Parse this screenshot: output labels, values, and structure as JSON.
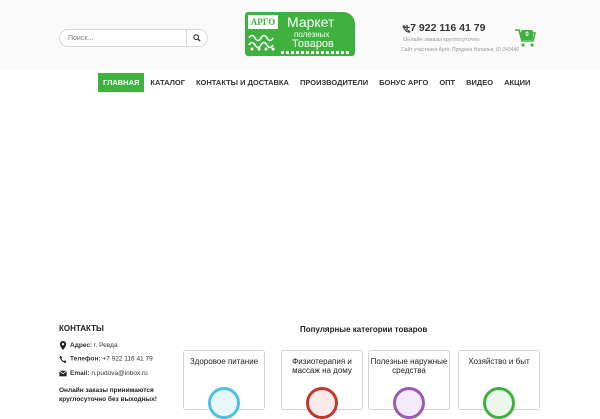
{
  "search": {
    "placeholder": "Поиск..."
  },
  "logo": {
    "badge": "АРГО",
    "line1": "Маркет",
    "line2": "полезных",
    "line3": "Товаров"
  },
  "header": {
    "phone": "+7 922 116 41 79",
    "online_note": "Онлайн заказы круглосуточно",
    "participant_note": "Сайт участника Арго: Прядина Наталья, ID 243440"
  },
  "cart": {
    "count": "0"
  },
  "nav": {
    "items": [
      {
        "label": "ГЛАВНАЯ"
      },
      {
        "label": "КАТАЛОГ"
      },
      {
        "label": "КОНТАКТЫ И ДОСТАВКА"
      },
      {
        "label": "ПРОИЗВОДИТЕЛИ"
      },
      {
        "label": "БОНУС АРГО"
      },
      {
        "label": "ОПТ"
      },
      {
        "label": "ВИДЕО"
      },
      {
        "label": "АКЦИИ"
      }
    ]
  },
  "contacts": {
    "title": "КОНТАКТЫ",
    "address_label": "Адрес:",
    "address_value": "г. Ревда",
    "phone_label": "Телефон:",
    "phone_value": "+7 922 116 41 79",
    "email_label": "Email:",
    "email_value": "n.pudova@inbox.ru",
    "online_text": "Онлайн заказы принимаются круглосуточно без выходных!"
  },
  "categories": {
    "title": "Популярные категории товаров",
    "items": [
      {
        "label": "Здоровое питание"
      },
      {
        "label": "Физиотерапия и массаж на дому"
      },
      {
        "label": "Полезные наружные средства"
      },
      {
        "label": "Хозяйство и быт"
      }
    ]
  },
  "colors": {
    "accent": "#3eb13e"
  }
}
